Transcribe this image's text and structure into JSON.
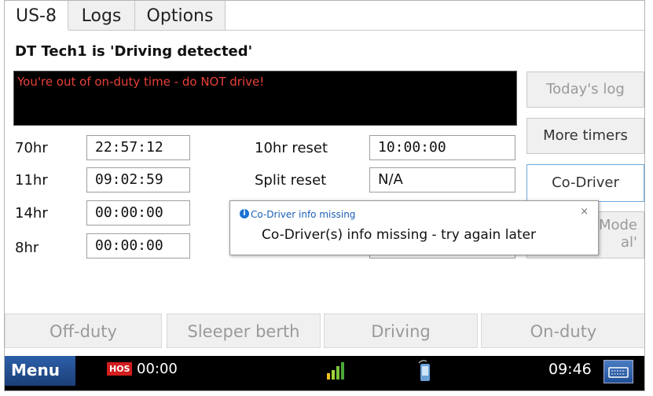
{
  "tabs": [
    {
      "label": "US-8"
    },
    {
      "label": "Logs"
    },
    {
      "label": "Options"
    }
  ],
  "status_line": "DT Tech1 is 'Driving detected'",
  "message": "You're out of on-duty time - do NOT drive!",
  "side_buttons": {
    "todays_log": "Today's log",
    "more_timers": "More timers",
    "co_driver": "Co-Driver",
    "mode_partial_1": "Mode",
    "mode_partial_2": "al'"
  },
  "timers_left": [
    {
      "label": "70hr",
      "value": "22:57:12"
    },
    {
      "label": "11hr",
      "value": "09:02:59"
    },
    {
      "label": "14hr",
      "value": "00:00:00"
    },
    {
      "label": "8hr",
      "value": "00:00:00"
    }
  ],
  "timers_right": [
    {
      "label": "10hr reset",
      "value": "10:00:00"
    },
    {
      "label": "Split reset",
      "value": "N/A"
    }
  ],
  "popup": {
    "title": "Co-Driver info missing",
    "body": "Co-Driver(s) info missing - try again later",
    "close": "×",
    "info_glyph": "i"
  },
  "duty_buttons": [
    "Off-duty",
    "Sleeper berth",
    "Driving",
    "On-duty"
  ],
  "taskbar": {
    "menu": "Menu",
    "hos_badge": "HOS",
    "hos_time": "00:00",
    "clock": "09:46"
  },
  "colors": {
    "message_text": "#e8413b",
    "taskbar_bg": "#000000",
    "popup_title": "#1a5fb4",
    "hos_badge": "#d21d1d"
  }
}
